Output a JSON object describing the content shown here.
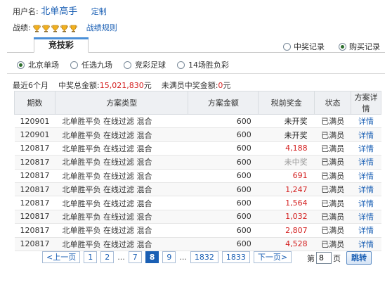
{
  "user": {
    "label": "用户名:",
    "name": "北单高手",
    "custom_link": "定制"
  },
  "record": {
    "label": "战绩:",
    "trophy_icons": [
      "cup-icon",
      "cup-icon",
      "cup-icon",
      "cup-icon",
      "cup-icon"
    ],
    "rule_link": "战绩规则"
  },
  "tabs": {
    "active": "竞技彩",
    "toggle_win": "中奖记录",
    "toggle_buy": "购买记录"
  },
  "lottery_types": [
    {
      "label": "北京单场",
      "selected": true
    },
    {
      "label": "任选九场",
      "selected": false
    },
    {
      "label": "竞彩足球",
      "selected": false
    },
    {
      "label": "14场胜负彩",
      "selected": false
    }
  ],
  "summary": {
    "period": "最近6个月",
    "total_label": "中奖总金额:",
    "total_value": "15,021,830",
    "total_unit": "元",
    "unfull_label": "未满员中奖金额:",
    "unfull_value": "0",
    "unfull_unit": "元"
  },
  "table": {
    "headers": [
      "期数",
      "方案类型",
      "方案金额",
      "税前奖金",
      "状态",
      "方案详情"
    ],
    "rows": [
      {
        "issue": "120901",
        "type": "北单胜平负 在线过滤 混合",
        "amount": "600",
        "prize": "未开奖",
        "prize_style": "dark",
        "status": "已满员",
        "detail": "详情"
      },
      {
        "issue": "120901",
        "type": "北单胜平负 在线过滤 混合",
        "amount": "600",
        "prize": "未开奖",
        "prize_style": "dark",
        "status": "已满员",
        "detail": "详情"
      },
      {
        "issue": "120817",
        "type": "北单胜平负 在线过滤 混合",
        "amount": "600",
        "prize": "4,188",
        "prize_style": "red",
        "status": "已满员",
        "detail": "详情"
      },
      {
        "issue": "120817",
        "type": "北单胜平负 在线过滤 混合",
        "amount": "600",
        "prize": "未中奖",
        "prize_style": "gray",
        "status": "已满员",
        "detail": "详情"
      },
      {
        "issue": "120817",
        "type": "北单胜平负 在线过滤 混合",
        "amount": "600",
        "prize": "691",
        "prize_style": "red",
        "status": "已满员",
        "detail": "详情"
      },
      {
        "issue": "120817",
        "type": "北单胜平负 在线过滤 混合",
        "amount": "600",
        "prize": "1,247",
        "prize_style": "red",
        "status": "已满员",
        "detail": "详情"
      },
      {
        "issue": "120817",
        "type": "北单胜平负 在线过滤 混合",
        "amount": "600",
        "prize": "1,564",
        "prize_style": "red",
        "status": "已满员",
        "detail": "详情"
      },
      {
        "issue": "120817",
        "type": "北单胜平负 在线过滤 混合",
        "amount": "600",
        "prize": "1,032",
        "prize_style": "red",
        "status": "已满员",
        "detail": "详情"
      },
      {
        "issue": "120817",
        "type": "北单胜平负 在线过滤 混合",
        "amount": "600",
        "prize": "2,807",
        "prize_style": "red",
        "status": "已满员",
        "detail": "详情"
      },
      {
        "issue": "120817",
        "type": "北单胜平负 在线过滤 混合",
        "amount": "600",
        "prize": "4,528",
        "prize_style": "red",
        "status": "已满员",
        "detail": "详情"
      }
    ]
  },
  "pagination": {
    "prev": "<上一页",
    "pages": [
      "1",
      "2",
      "...",
      "7",
      "8",
      "9",
      "...",
      "1832",
      "1833"
    ],
    "current": "8",
    "next": "下一页>",
    "jump_label_before": "第",
    "jump_value": "8",
    "jump_label_after": "页",
    "go_button": "跳转"
  },
  "colors": {
    "link": "#1a5fb4",
    "prize_red": "#d42020",
    "tab_accent": "#4a8fd8",
    "header_bg": "#eef0f3"
  }
}
